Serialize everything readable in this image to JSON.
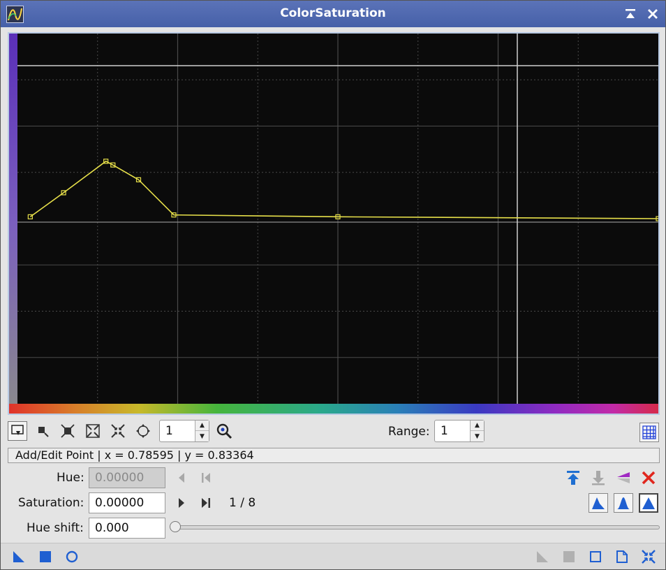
{
  "window": {
    "title": "ColorSaturation"
  },
  "toolbar": {
    "zoom_value": "1",
    "range_label": "Range:",
    "range_value": "1"
  },
  "status": {
    "text": "Add/Edit Point | x = 0.78595 | y = 0.83364"
  },
  "fields": {
    "hue_label": "Hue:",
    "hue_value": "0.00000",
    "saturation_label": "Saturation:",
    "saturation_value": "0.00000",
    "point_counter": "1 / 8",
    "hue_shift_label": "Hue shift:",
    "hue_shift_value": "0.000"
  },
  "slider": {
    "hue_shift_fraction": 0.0
  },
  "curve": {
    "x_domain": [
      0,
      1
    ],
    "y_domain": [
      -1,
      1
    ],
    "points": [
      {
        "x": 0.02,
        "y": 0.01
      },
      {
        "x": 0.072,
        "y": 0.14
      },
      {
        "x": 0.138,
        "y": 0.31
      },
      {
        "x": 0.149,
        "y": 0.29
      },
      {
        "x": 0.189,
        "y": 0.21
      },
      {
        "x": 0.244,
        "y": 0.02
      },
      {
        "x": 0.5,
        "y": 0.01
      },
      {
        "x": 1.0,
        "y": 0.0
      }
    ]
  },
  "colors": {
    "curve": "#e7e04a",
    "accent": "#1f6fd1",
    "delete": "#e0261d"
  },
  "icons": {
    "edit_mode": "add-edit-point-icon",
    "select": "select-point-icon",
    "delete_point": "delete-point-icon",
    "zoom_in": "zoom-in-icon",
    "zoom_out": "zoom-out-icon",
    "pan": "pan-icon",
    "zoom_tool": "magnifier-icon",
    "grid": "grid-icon"
  }
}
